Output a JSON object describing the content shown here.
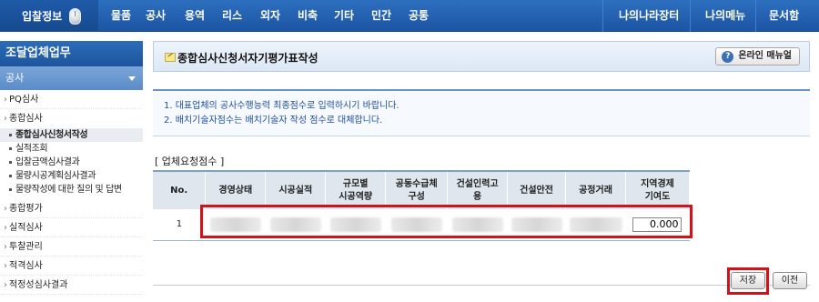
{
  "topnav": {
    "brand": "입찰정보",
    "items": [
      "물품",
      "공사",
      "용역",
      "리스",
      "외자",
      "비축",
      "기타",
      "민간",
      "공통"
    ],
    "right_items": [
      "나의나라장터",
      "나의메뉴",
      "문서함"
    ]
  },
  "sidebar": {
    "title": "조달업체업무",
    "section": "공사",
    "items": [
      {
        "label": "PQ심사"
      },
      {
        "label": "종합심사",
        "children": [
          "종합심사신청서작성",
          "실적조회",
          "입찰금액심사결과",
          "물량시공계획심사결과",
          "물량작성에 대한 질의 및 답변"
        ]
      },
      {
        "label": "종합평가"
      },
      {
        "label": "실적심사"
      },
      {
        "label": "투찰관리"
      },
      {
        "label": "적격심사"
      },
      {
        "label": "적정성심사결과"
      }
    ],
    "active_child": "종합심사신청서작성"
  },
  "page": {
    "title": "종합심사신청서자기평가표작성",
    "manual_button": "온라인 매뉴얼",
    "notices": [
      "1. 대표업체의 공사수행능력 최종점수로 입력하시기 바랍니다.",
      "2. 배치기술자점수는 배치기술자 작성 점수로 대체합니다."
    ],
    "section_label": "[ 업체요청점수 ]",
    "table": {
      "headers": [
        "No.",
        "경영상태",
        "시공실적",
        "규모별\n시공역량",
        "공동수급체\n구성",
        "건설인력고\n용",
        "건설안전",
        "공정거래",
        "지역경제\n기여도"
      ],
      "row": {
        "no": "1",
        "value": "0.000"
      }
    },
    "buttons": {
      "save": "저장",
      "prev": "이전"
    }
  }
}
